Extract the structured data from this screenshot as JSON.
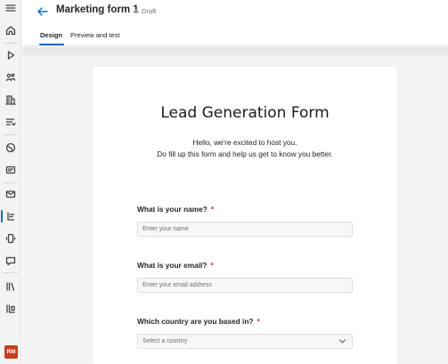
{
  "header": {
    "title": "Marketing form 1",
    "status": "Draft"
  },
  "tabs": [
    {
      "label": "Design",
      "active": true
    },
    {
      "label": "Preview and test",
      "active": false
    }
  ],
  "rail": {
    "icons": [
      "menu-icon",
      "home-icon",
      "play-icon",
      "segments-icon",
      "building-icon",
      "journey-icon",
      "globe-icon",
      "email-template-icon",
      "email-icon",
      "form-icon",
      "phone-icon",
      "chat-icon",
      "library-icon",
      "assets-icon"
    ],
    "active_icon": "form-icon",
    "avatar_initials": "RM",
    "accent": "#0f6cbd",
    "avatar_color": "#c43e1c"
  },
  "form": {
    "title": "Lead Generation Form",
    "intro_line1": "Hello, we're excited to host you.",
    "intro_line2": "Do fill up this form and help us get to know you better.",
    "questions": [
      {
        "label": "What is your name?",
        "required_mark": "*",
        "placeholder": "Enter your name",
        "type": "text"
      },
      {
        "label": "What is your email?",
        "required_mark": "*",
        "placeholder": "Enter your email address",
        "type": "text"
      },
      {
        "label": "Which country are you based in?",
        "required_mark": "*",
        "placeholder": "Select a country",
        "type": "select"
      }
    ]
  }
}
